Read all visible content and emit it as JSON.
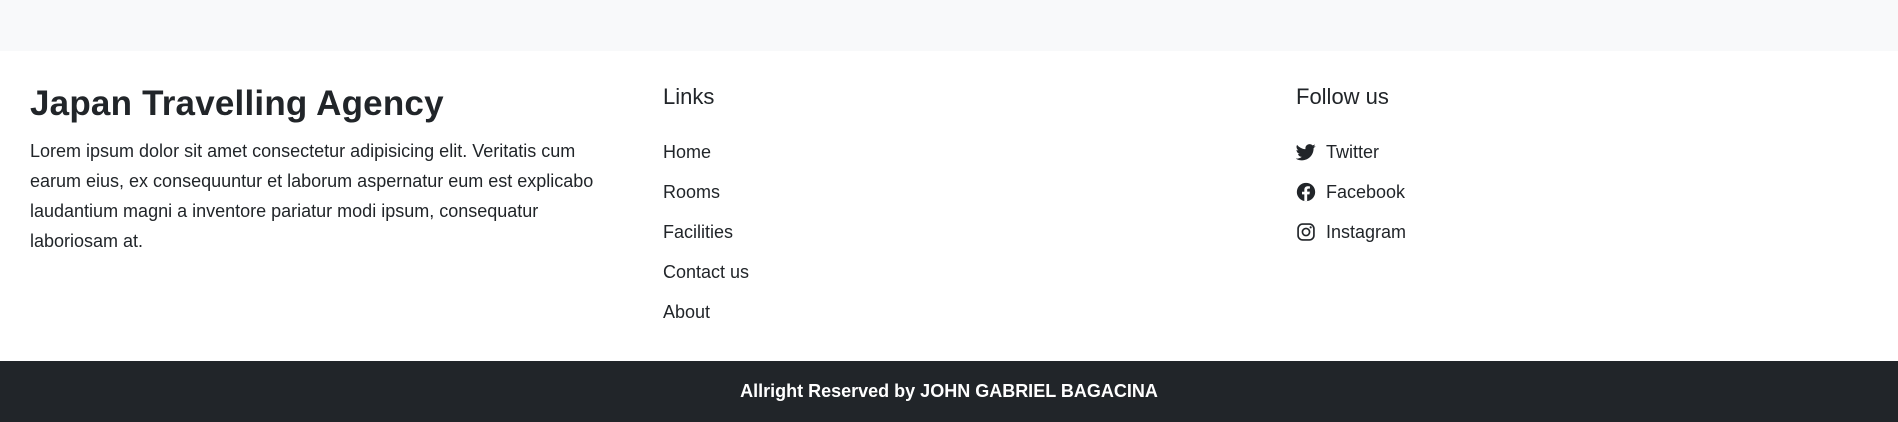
{
  "brand": {
    "title": "Japan Travelling Agency",
    "description": "Lorem ipsum dolor sit amet consectetur adipisicing elit. Veritatis cum earum eius, ex consequuntur et laborum aspernatur eum est explicabo laudantium magni a inventore pariatur modi ipsum, consequatur laboriosam at."
  },
  "links": {
    "heading": "Links",
    "items": [
      "Home",
      "Rooms",
      "Facilities",
      "Contact us",
      "About"
    ]
  },
  "follow": {
    "heading": "Follow us",
    "items": [
      {
        "label": "Twitter",
        "icon": "twitter-icon"
      },
      {
        "label": "Facebook",
        "icon": "facebook-icon"
      },
      {
        "label": "Instagram",
        "icon": "instagram-icon"
      }
    ]
  },
  "footer": {
    "copyright": "Allright Reserved by JOHN GABRIEL BAGACINA"
  },
  "colors": {
    "top_strip": "#f8f9fa",
    "text": "#212529",
    "bottom_bar": "#212529",
    "bottom_text": "#ffffff"
  }
}
